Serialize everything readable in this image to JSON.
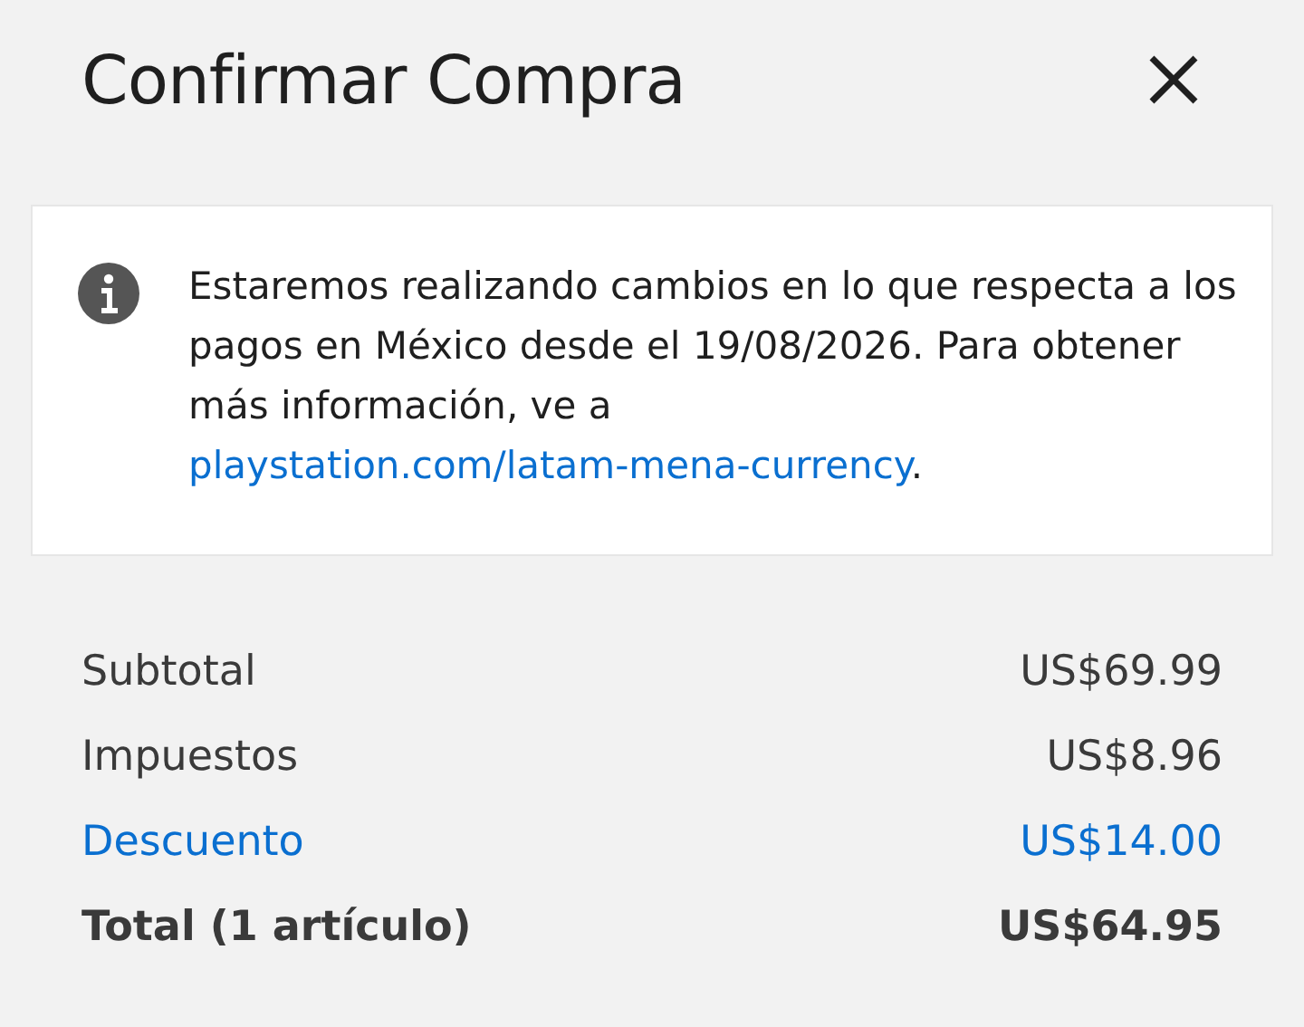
{
  "title": "Confirmar Compra",
  "notice": {
    "text": "Estaremos realizando cambios en lo que respecta a los pagos en México desde el 19/08/2026. Para obtener más información, ve a ",
    "link": "playstation.com/latam-mena-currency",
    "after": "."
  },
  "summary": [
    {
      "kind": "normal",
      "label": "Subtotal",
      "amount": "US$69.99"
    },
    {
      "kind": "normal",
      "label": "Impuestos",
      "amount": "US$8.96"
    },
    {
      "kind": "discount",
      "label": "Descuento",
      "amount": "US$14.00"
    },
    {
      "kind": "total",
      "label": "Total (1 artículo)",
      "amount": "US$64.95"
    }
  ]
}
